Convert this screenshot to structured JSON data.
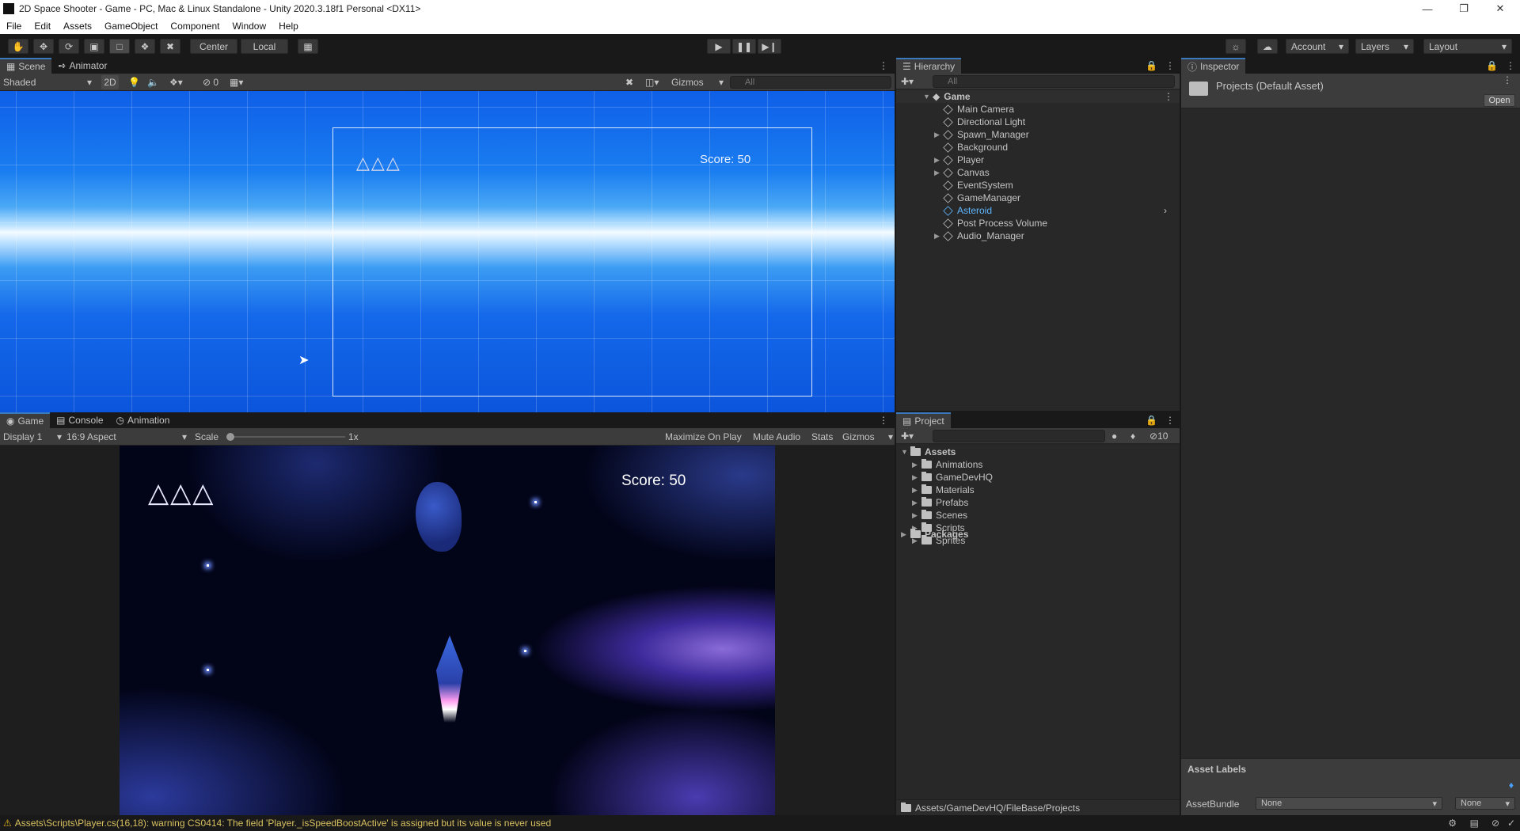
{
  "window": {
    "title": "2D Space Shooter - Game - PC, Mac & Linux Standalone - Unity 2020.3.18f1 Personal <DX11>"
  },
  "menu": [
    "File",
    "Edit",
    "Assets",
    "GameObject",
    "Component",
    "Window",
    "Help"
  ],
  "toolbar": {
    "pivot": "Center",
    "space": "Local",
    "account": "Account",
    "layers": "Layers",
    "layout": "Layout"
  },
  "scene_panel": {
    "tabs": [
      "Scene",
      "Animator"
    ],
    "shading": "Shaded",
    "mode_2d": "2D",
    "hidden_count": "0",
    "gizmos": "Gizmos",
    "search_placeholder": "All",
    "score_text": "Score: 50"
  },
  "game_panel": {
    "tabs": [
      "Game",
      "Console",
      "Animation"
    ],
    "display": "Display 1",
    "aspect": "16:9 Aspect",
    "scale_label": "Scale",
    "scale_value": "1x",
    "maximize": "Maximize On Play",
    "mute": "Mute Audio",
    "stats": "Stats",
    "gizmos": "Gizmos",
    "score_text": "Score: 50"
  },
  "hierarchy": {
    "tab": "Hierarchy",
    "search_placeholder": "All",
    "root": "Game",
    "items": [
      {
        "label": "Main Camera",
        "expandable": false
      },
      {
        "label": "Directional Light",
        "expandable": false
      },
      {
        "label": "Spawn_Manager",
        "expandable": true
      },
      {
        "label": "Background",
        "expandable": false
      },
      {
        "label": "Player",
        "expandable": true
      },
      {
        "label": "Canvas",
        "expandable": true
      },
      {
        "label": "EventSystem",
        "expandable": false
      },
      {
        "label": "GameManager",
        "expandable": false
      },
      {
        "label": "Asteroid",
        "expandable": false,
        "highlight": true
      },
      {
        "label": "Post Process Volume",
        "expandable": false
      },
      {
        "label": "Audio_Manager",
        "expandable": true
      }
    ]
  },
  "inspector": {
    "tab": "Inspector",
    "title": "Projects (Default Asset)",
    "open_button": "Open",
    "asset_labels": "Asset Labels",
    "asset_bundle_label": "AssetBundle",
    "asset_bundle_value": "None",
    "asset_bundle_variant": "None"
  },
  "project": {
    "tab": "Project",
    "hidden_count": "10",
    "root": "Assets",
    "folders": [
      "Animations",
      "GameDevHQ",
      "Materials",
      "Prefabs",
      "Scenes",
      "Scripts",
      "Sprites"
    ],
    "packages": "Packages",
    "path": "Assets/GameDevHQ/FileBase/Projects"
  },
  "status": {
    "message": "Assets\\Scripts\\Player.cs(16,18): warning CS0414: The field 'Player._isSpeedBoostActive' is assigned but its value is never used"
  },
  "colors": {
    "accent": "#3a79bb",
    "highlight_text": "#5eb6ff",
    "warning": "#d8c060"
  }
}
